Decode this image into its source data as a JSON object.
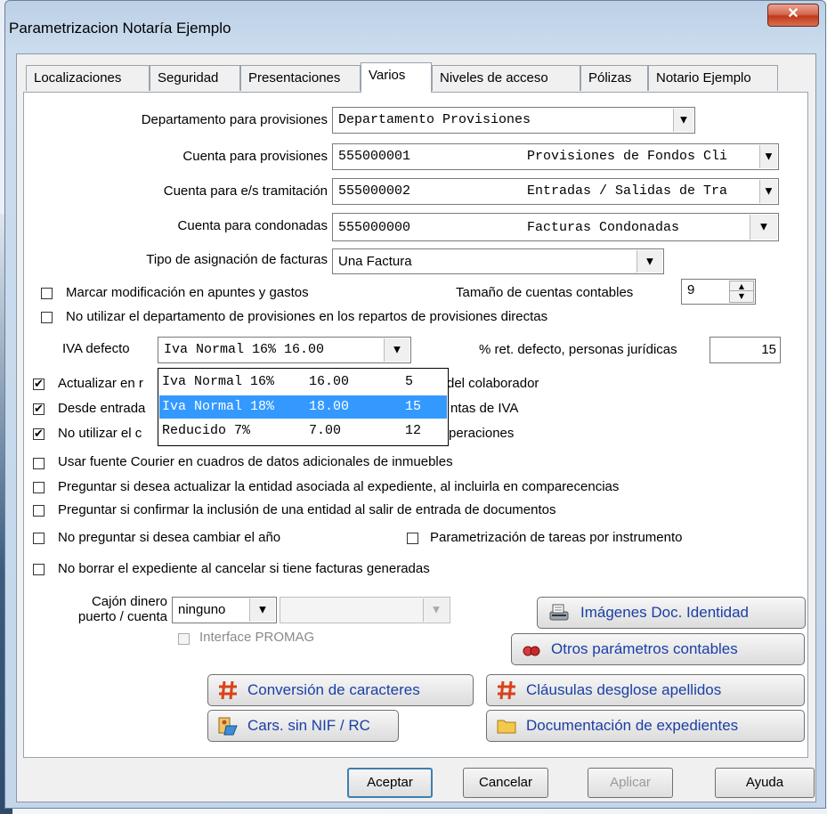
{
  "window": {
    "title": "Parametrizacion Notaría Ejemplo",
    "close": "✕"
  },
  "tabs": [
    {
      "label": "Localizaciones"
    },
    {
      "label": "Seguridad"
    },
    {
      "label": "Presentaciones"
    },
    {
      "label": "Varios"
    },
    {
      "label": "Niveles de acceso"
    },
    {
      "label": "Pólizas"
    },
    {
      "label": "Notario Ejemplo"
    }
  ],
  "form": {
    "departamento": {
      "label": "Departamento para provisiones",
      "value": "Departamento Provisiones"
    },
    "cuenta_prov": {
      "label": "Cuenta para provisiones",
      "code": "555000001",
      "desc": "Provisiones de Fondos Cli"
    },
    "cuenta_tram": {
      "label": "Cuenta para e/s tramitación",
      "code": "555000002",
      "desc": "Entradas / Salidas de Tra"
    },
    "cuenta_cond": {
      "label": "Cuenta para condonadas",
      "code": "555000000",
      "desc": "Facturas Condonadas"
    },
    "tipo_asig": {
      "label": "Tipo de asignación de facturas",
      "value": "Una Factura"
    },
    "tamano": {
      "label": "Tamaño de cuentas contables",
      "value": "9"
    },
    "iva": {
      "label": "IVA defecto",
      "value": "Iva Normal 16%   16.00"
    },
    "ret": {
      "label": "% ret. defecto, personas jurídicas",
      "value": "15"
    },
    "cajon": {
      "label1": "Cajón dinero",
      "label2": "puerto / cuenta",
      "value": "ninguno"
    }
  },
  "checks": {
    "marcar": {
      "label": "Marcar modificación en apuntes y gastos",
      "checked": false
    },
    "noutil_dep": {
      "label": "No utilizar el departamento de provisiones en los repartos de provisiones directas",
      "checked": false
    },
    "actualizar": {
      "label_a": "Actualizar en r",
      "label_b": "del colaborador",
      "checked": true
    },
    "desde": {
      "label_a": "Desde entrada",
      "label_b": "ntas de IVA",
      "checked": true
    },
    "noutil_c": {
      "label_a": "No utilizar el c",
      "label_b": "peraciones",
      "checked": true
    },
    "courier": {
      "label": "Usar fuente Courier en cuadros de datos adicionales de inmuebles",
      "checked": false
    },
    "preg_ent": {
      "label": "Preguntar si desea actualizar la entidad asociada al expediente, al incluirla en comparecencias",
      "checked": false
    },
    "preg_conf": {
      "label": "Preguntar si confirmar la inclusión de una entidad al salir de entrada de documentos",
      "checked": false
    },
    "no_anio": {
      "label": "No preguntar si desea cambiar el año",
      "checked": false
    },
    "param_tareas": {
      "label": "Parametrización de tareas por instrumento",
      "checked": false
    },
    "no_borrar": {
      "label": "No borrar el expediente al cancelar si tiene facturas generadas",
      "checked": false
    },
    "promag": {
      "label": "Interface PROMAG",
      "checked": false
    }
  },
  "iva_options": [
    {
      "name": "Iva Normal 16%",
      "rate": "16.00",
      "code": "5"
    },
    {
      "name": "Iva Normal 18%",
      "rate": "18.00",
      "code": "15"
    },
    {
      "name": "Reducido 7%",
      "rate": "7.00",
      "code": "12"
    }
  ],
  "buttons": {
    "imagenes": "Imágenes Doc. Identidad",
    "otros": "Otros parámetros contables",
    "conversion": "Conversión de caracteres",
    "clausulas": "Cláusulas desglose apellidos",
    "cars": "Cars. sin NIF / RC",
    "documentacion": "Documentación de expedientes"
  },
  "dialog": {
    "aceptar": "Aceptar",
    "cancelar": "Cancelar",
    "aplicar": "Aplicar",
    "ayuda": "Ayuda"
  },
  "glyphs": {
    "down": "▼",
    "up": "▲",
    "check": "✔"
  }
}
